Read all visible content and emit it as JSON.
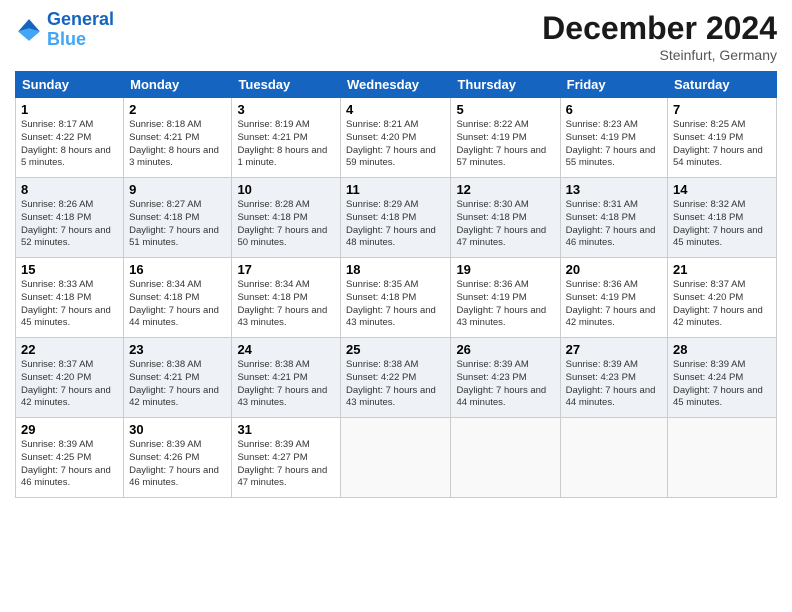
{
  "header": {
    "logo_line1": "General",
    "logo_line2": "Blue",
    "month": "December 2024",
    "location": "Steinfurt, Germany"
  },
  "weekdays": [
    "Sunday",
    "Monday",
    "Tuesday",
    "Wednesday",
    "Thursday",
    "Friday",
    "Saturday"
  ],
  "weeks": [
    [
      {
        "day": "1",
        "sunrise": "Sunrise: 8:17 AM",
        "sunset": "Sunset: 4:22 PM",
        "daylight": "Daylight: 8 hours and 5 minutes."
      },
      {
        "day": "2",
        "sunrise": "Sunrise: 8:18 AM",
        "sunset": "Sunset: 4:21 PM",
        "daylight": "Daylight: 8 hours and 3 minutes."
      },
      {
        "day": "3",
        "sunrise": "Sunrise: 8:19 AM",
        "sunset": "Sunset: 4:21 PM",
        "daylight": "Daylight: 8 hours and 1 minute."
      },
      {
        "day": "4",
        "sunrise": "Sunrise: 8:21 AM",
        "sunset": "Sunset: 4:20 PM",
        "daylight": "Daylight: 7 hours and 59 minutes."
      },
      {
        "day": "5",
        "sunrise": "Sunrise: 8:22 AM",
        "sunset": "Sunset: 4:19 PM",
        "daylight": "Daylight: 7 hours and 57 minutes."
      },
      {
        "day": "6",
        "sunrise": "Sunrise: 8:23 AM",
        "sunset": "Sunset: 4:19 PM",
        "daylight": "Daylight: 7 hours and 55 minutes."
      },
      {
        "day": "7",
        "sunrise": "Sunrise: 8:25 AM",
        "sunset": "Sunset: 4:19 PM",
        "daylight": "Daylight: 7 hours and 54 minutes."
      }
    ],
    [
      {
        "day": "8",
        "sunrise": "Sunrise: 8:26 AM",
        "sunset": "Sunset: 4:18 PM",
        "daylight": "Daylight: 7 hours and 52 minutes."
      },
      {
        "day": "9",
        "sunrise": "Sunrise: 8:27 AM",
        "sunset": "Sunset: 4:18 PM",
        "daylight": "Daylight: 7 hours and 51 minutes."
      },
      {
        "day": "10",
        "sunrise": "Sunrise: 8:28 AM",
        "sunset": "Sunset: 4:18 PM",
        "daylight": "Daylight: 7 hours and 50 minutes."
      },
      {
        "day": "11",
        "sunrise": "Sunrise: 8:29 AM",
        "sunset": "Sunset: 4:18 PM",
        "daylight": "Daylight: 7 hours and 48 minutes."
      },
      {
        "day": "12",
        "sunrise": "Sunrise: 8:30 AM",
        "sunset": "Sunset: 4:18 PM",
        "daylight": "Daylight: 7 hours and 47 minutes."
      },
      {
        "day": "13",
        "sunrise": "Sunrise: 8:31 AM",
        "sunset": "Sunset: 4:18 PM",
        "daylight": "Daylight: 7 hours and 46 minutes."
      },
      {
        "day": "14",
        "sunrise": "Sunrise: 8:32 AM",
        "sunset": "Sunset: 4:18 PM",
        "daylight": "Daylight: 7 hours and 45 minutes."
      }
    ],
    [
      {
        "day": "15",
        "sunrise": "Sunrise: 8:33 AM",
        "sunset": "Sunset: 4:18 PM",
        "daylight": "Daylight: 7 hours and 45 minutes."
      },
      {
        "day": "16",
        "sunrise": "Sunrise: 8:34 AM",
        "sunset": "Sunset: 4:18 PM",
        "daylight": "Daylight: 7 hours and 44 minutes."
      },
      {
        "day": "17",
        "sunrise": "Sunrise: 8:34 AM",
        "sunset": "Sunset: 4:18 PM",
        "daylight": "Daylight: 7 hours and 43 minutes."
      },
      {
        "day": "18",
        "sunrise": "Sunrise: 8:35 AM",
        "sunset": "Sunset: 4:18 PM",
        "daylight": "Daylight: 7 hours and 43 minutes."
      },
      {
        "day": "19",
        "sunrise": "Sunrise: 8:36 AM",
        "sunset": "Sunset: 4:19 PM",
        "daylight": "Daylight: 7 hours and 43 minutes."
      },
      {
        "day": "20",
        "sunrise": "Sunrise: 8:36 AM",
        "sunset": "Sunset: 4:19 PM",
        "daylight": "Daylight: 7 hours and 42 minutes."
      },
      {
        "day": "21",
        "sunrise": "Sunrise: 8:37 AM",
        "sunset": "Sunset: 4:20 PM",
        "daylight": "Daylight: 7 hours and 42 minutes."
      }
    ],
    [
      {
        "day": "22",
        "sunrise": "Sunrise: 8:37 AM",
        "sunset": "Sunset: 4:20 PM",
        "daylight": "Daylight: 7 hours and 42 minutes."
      },
      {
        "day": "23",
        "sunrise": "Sunrise: 8:38 AM",
        "sunset": "Sunset: 4:21 PM",
        "daylight": "Daylight: 7 hours and 42 minutes."
      },
      {
        "day": "24",
        "sunrise": "Sunrise: 8:38 AM",
        "sunset": "Sunset: 4:21 PM",
        "daylight": "Daylight: 7 hours and 43 minutes."
      },
      {
        "day": "25",
        "sunrise": "Sunrise: 8:38 AM",
        "sunset": "Sunset: 4:22 PM",
        "daylight": "Daylight: 7 hours and 43 minutes."
      },
      {
        "day": "26",
        "sunrise": "Sunrise: 8:39 AM",
        "sunset": "Sunset: 4:23 PM",
        "daylight": "Daylight: 7 hours and 44 minutes."
      },
      {
        "day": "27",
        "sunrise": "Sunrise: 8:39 AM",
        "sunset": "Sunset: 4:23 PM",
        "daylight": "Daylight: 7 hours and 44 minutes."
      },
      {
        "day": "28",
        "sunrise": "Sunrise: 8:39 AM",
        "sunset": "Sunset: 4:24 PM",
        "daylight": "Daylight: 7 hours and 45 minutes."
      }
    ],
    [
      {
        "day": "29",
        "sunrise": "Sunrise: 8:39 AM",
        "sunset": "Sunset: 4:25 PM",
        "daylight": "Daylight: 7 hours and 46 minutes."
      },
      {
        "day": "30",
        "sunrise": "Sunrise: 8:39 AM",
        "sunset": "Sunset: 4:26 PM",
        "daylight": "Daylight: 7 hours and 46 minutes."
      },
      {
        "day": "31",
        "sunrise": "Sunrise: 8:39 AM",
        "sunset": "Sunset: 4:27 PM",
        "daylight": "Daylight: 7 hours and 47 minutes."
      },
      null,
      null,
      null,
      null
    ]
  ]
}
